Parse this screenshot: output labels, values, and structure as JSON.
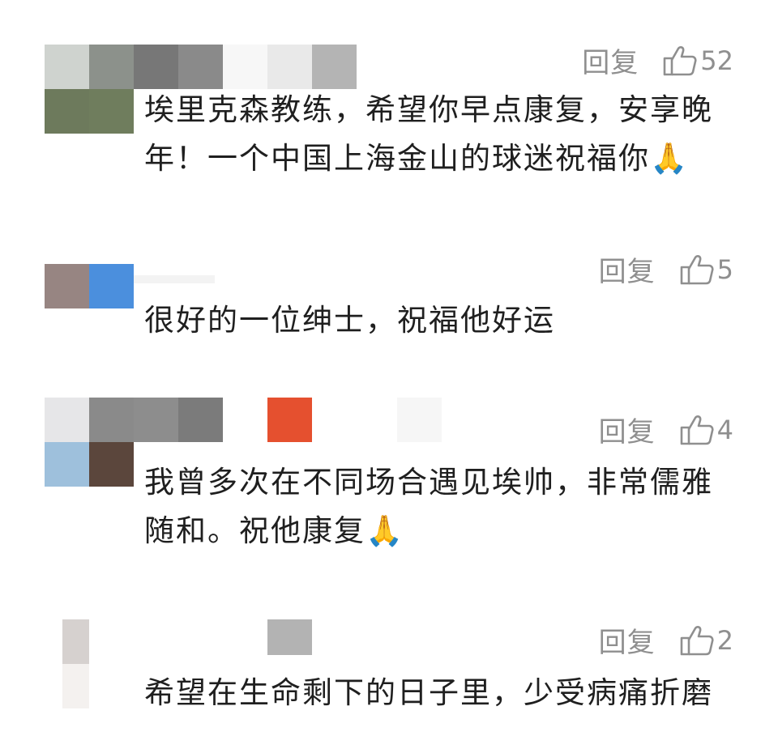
{
  "comments": [
    {
      "reply_label": "回复",
      "like_count": "52",
      "text": "埃里克森教练，希望你早点康复，安享晚年！一个中国上海金山的球迷祝福你",
      "emoji": "🙏"
    },
    {
      "reply_label": "回复",
      "like_count": "5",
      "text": "很好的一位绅士，祝福他好运",
      "emoji": ""
    },
    {
      "reply_label": "回复",
      "like_count": "4",
      "text": "我曾多次在不同场合遇见埃帅，非常儒雅随和。祝他康复",
      "emoji": "🙏"
    },
    {
      "reply_label": "回复",
      "like_count": "2",
      "text": "希望在生命剩下的日子里，少受病痛折磨",
      "emoji": ""
    }
  ],
  "icons": {
    "like": "thumbs-up-icon",
    "pray": "praying-hands-emoji"
  },
  "colors": {
    "meta": "#8f8f8f",
    "text": "#1f1f1f",
    "background": "#ffffff"
  }
}
